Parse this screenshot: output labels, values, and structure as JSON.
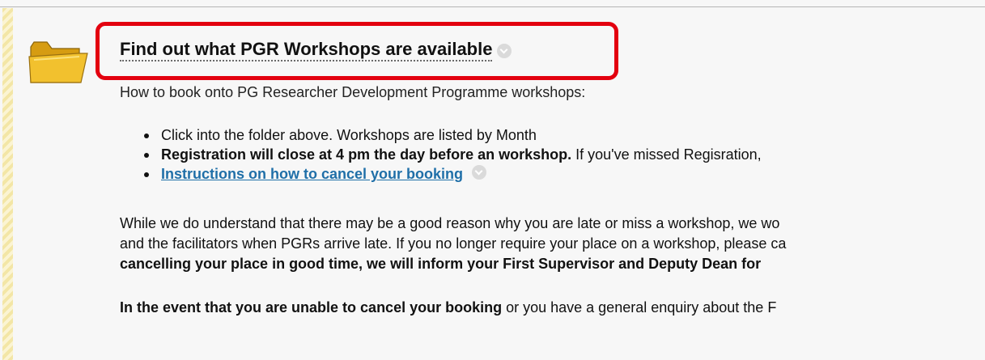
{
  "section": {
    "title": "Find out what PGR Workshops are available",
    "intro": "How to book onto PG Researcher Development Programme workshops:"
  },
  "bullets": [
    {
      "text": "Click into the folder above.  Workshops are listed by Month"
    },
    {
      "bold": "Registration will close at 4 pm the day before an workshop.",
      "text": "If you've missed Regisration,"
    },
    {
      "link": "Instructions on how to cancel your booking"
    }
  ],
  "paragraph1": {
    "line1": "While we do understand that there may be a good reason why you are late or miss a workshop, we wo",
    "line2": "and the facilitators when PGRs arrive late. If you no longer require your place on a workshop, please ca",
    "line3_bold": "cancelling your place in good time, we will inform your First Supervisor and Deputy Dean for"
  },
  "paragraph2": {
    "bold": "In the event that you are unable to cancel your booking",
    "text": "or you have a general enquiry about the F"
  },
  "icons": {
    "folder": "folder-icon",
    "menu": "chevron-down-icon"
  },
  "colors": {
    "highlight_border": "#e3000f",
    "link": "#1f6fa8",
    "folder": "#f2c12e"
  }
}
